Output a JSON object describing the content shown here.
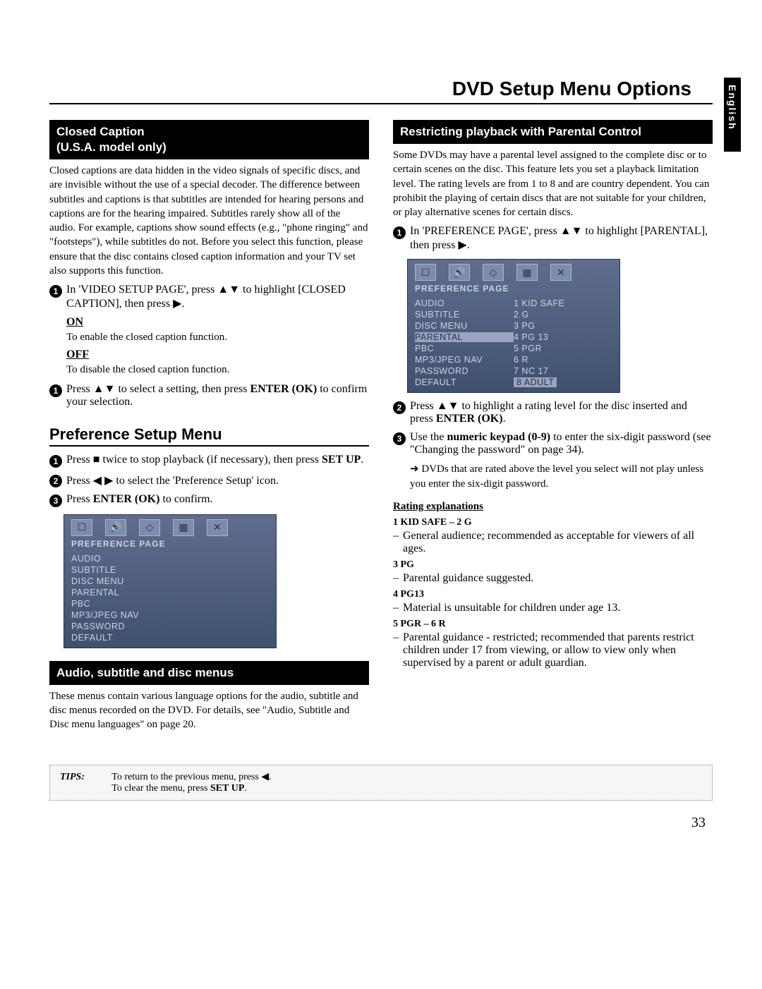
{
  "lang_tab": "English",
  "page_title": "DVD Setup Menu Options",
  "page_number": "33",
  "left": {
    "closed_caption": {
      "header": "Closed Caption\n(U.S.A. model only)",
      "para": "Closed captions are data hidden in the video signals of specific discs, and are invisible without the use of a special decoder. The difference between subtitles and captions is that subtitles are intended for hearing persons and captions are for the hearing impaired. Subtitles rarely show all of the audio. For example, captions show sound effects (e.g., \"phone ringing\" and \"footsteps\"), while subtitles do not. Before you select this function, please ensure that the disc contains closed caption information and your TV set also supports this function.",
      "step1": "In 'VIDEO SETUP PAGE', press ▲▼ to highlight [CLOSED CAPTION], then press ▶.",
      "on_label": "ON",
      "on_desc": "To enable the closed caption function.",
      "off_label": "OFF",
      "off_desc": "To disable the closed caption function.",
      "step_confirm_pre": "Press ▲▼ to select a setting, then press ",
      "step_confirm_b1": "ENTER (OK)",
      "step_confirm_post": " to confirm your selection."
    },
    "pref_menu": {
      "title": "Preference Setup Menu",
      "s1_pre": "Press ■ twice to stop playback (if necessary), then press ",
      "s1_b": "SET UP",
      "s1_post": ".",
      "s2": "Press ◀ ▶ to select the 'Preference Setup' icon.",
      "s3_pre": "Press ",
      "s3_b": "ENTER (OK)",
      "s3_post": " to confirm."
    },
    "osd1": {
      "label": "PREFERENCE PAGE",
      "items": [
        "AUDIO",
        "SUBTITLE",
        "DISC MENU",
        "PARENTAL",
        "PBC",
        "MP3/JPEG NAV",
        "PASSWORD",
        "DEFAULT"
      ]
    },
    "audio_menus": {
      "header": "Audio, subtitle and disc menus",
      "para": "These menus contain various language options for the audio, subtitle and disc menus recorded on the DVD. For details, see \"Audio, Subtitle and Disc menu languages\" on page 20."
    }
  },
  "right": {
    "parental": {
      "header": "Restricting playback with Parental Control",
      "para": "Some DVDs may have a parental level assigned to the complete disc or to certain scenes on the disc. This feature lets you set a playback limitation level. The rating levels are from 1 to 8 and are country dependent. You can prohibit the playing of certain discs that are not suitable for your children, or play alternative scenes for certain discs.",
      "s1": "In 'PREFERENCE PAGE', press ▲▼ to highlight [PARENTAL], then press ▶."
    },
    "osd2": {
      "label": "PREFERENCE PAGE",
      "left_items": [
        "AUDIO",
        "SUBTITLE",
        "DISC MENU",
        "PARENTAL",
        "PBC",
        "MP3/JPEG NAV",
        "PASSWORD",
        "DEFAULT"
      ],
      "right_items": [
        "1 KID SAFE",
        "2 G",
        "3 PG",
        "4 PG 13",
        "5 PGR",
        "6 R",
        "7 NC 17",
        "8 ADULT"
      ],
      "highlight_left_index": 3,
      "highlight_right_index": 7
    },
    "s2_pre": "Press ▲▼ to highlight a rating level for the disc inserted and press ",
    "s2_b": "ENTER (OK)",
    "s2_post": ".",
    "s3_pre": "Use the ",
    "s3_b": "numeric keypad (0-9)",
    "s3_post": " to enter the six-digit password (see \"Changing the password\" on page 34).",
    "s3_arrow": "➜ DVDs that are rated above the level you select will not play unless you enter the six-digit password.",
    "ratings_header": "Rating explanations",
    "ratings": [
      {
        "t": "1 KID SAFE – 2 G",
        "d": "General audience; recommended as acceptable for viewers of all ages."
      },
      {
        "t": "3 PG",
        "d": "Parental guidance suggested."
      },
      {
        "t": "4 PG13",
        "d": "Material is unsuitable for children under age 13."
      },
      {
        "t": "5 PGR – 6 R",
        "d": "Parental guidance - restricted; recommended that parents restrict children under 17 from viewing, or allow to view only when supervised by a parent or adult guardian."
      }
    ]
  },
  "tips": {
    "label": "TIPS:",
    "l1_pre": "To return to the previous menu, press ◀.",
    "l2_pre": "To clear the menu, press ",
    "l2_b": "SET UP",
    "l2_post": "."
  }
}
